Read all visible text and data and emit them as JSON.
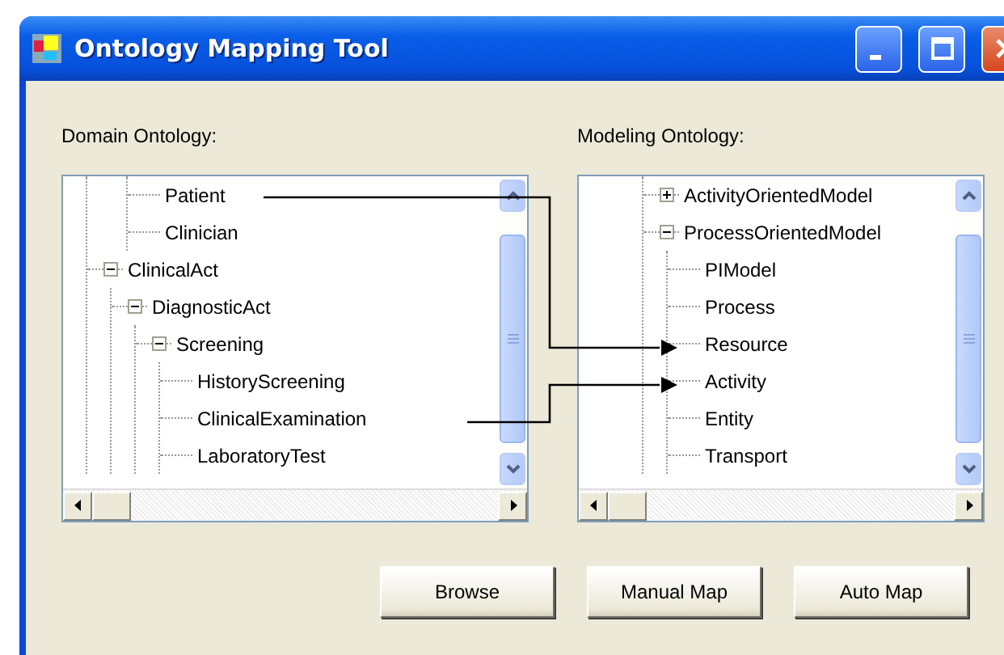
{
  "window": {
    "title": "Ontology Mapping Tool"
  },
  "domain": {
    "label": "Domain Ontology:",
    "items": [
      {
        "children": [
          {
            "label": "Patient"
          },
          {
            "label": "Clinician"
          }
        ]
      },
      {
        "label": "ClinicalAct",
        "expanded": true,
        "children": [
          {
            "label": "DiagnosticAct",
            "expanded": true,
            "children": [
              {
                "label": "Screening",
                "expanded": true,
                "children": [
                  {
                    "label": "HistoryScreening"
                  },
                  {
                    "label": "ClinicalExamination"
                  },
                  {
                    "label": "LaboratoryTest"
                  }
                ]
              }
            ]
          }
        ]
      }
    ]
  },
  "modeling": {
    "label": "Modeling Ontology:",
    "items": [
      {
        "children": [
          {
            "label": "ActivityOrientedModel",
            "expanded": false
          },
          {
            "label": "ProcessOrientedModel",
            "expanded": true,
            "children": [
              {
                "label": "PIModel"
              },
              {
                "label": "Process"
              },
              {
                "label": "Resource"
              },
              {
                "label": "Activity"
              },
              {
                "label": "Entity"
              },
              {
                "label": "Transport"
              }
            ]
          }
        ]
      }
    ]
  },
  "buttons": [
    "Browse",
    "Manual Map",
    "Auto Map"
  ]
}
